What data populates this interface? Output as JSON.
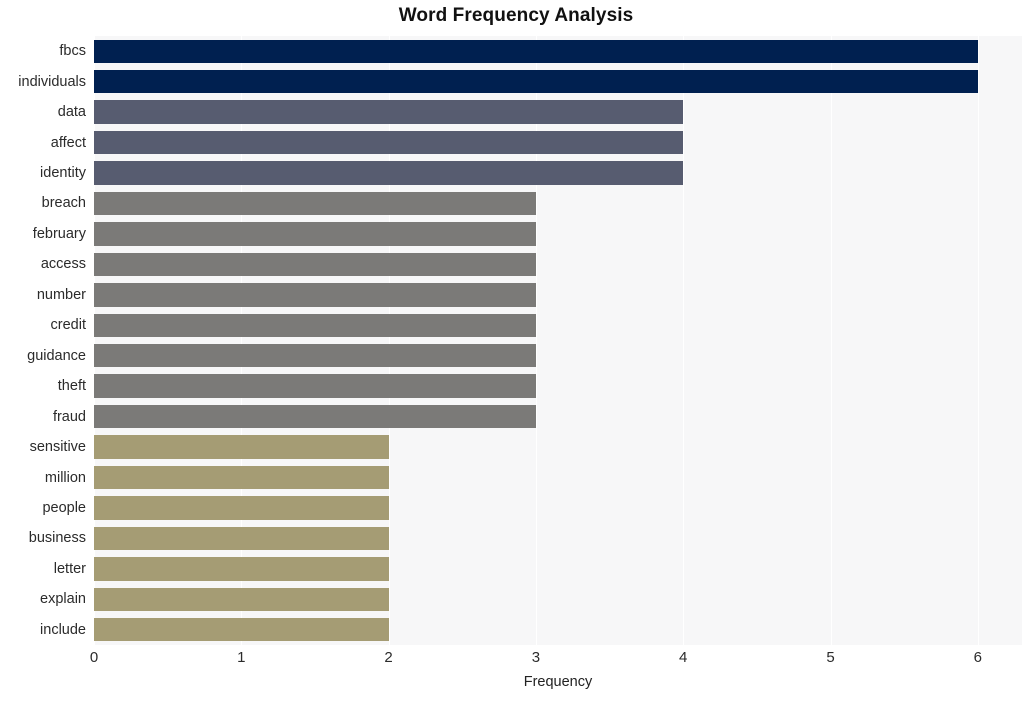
{
  "chart_data": {
    "type": "bar",
    "orientation": "horizontal",
    "title": "Word Frequency Analysis",
    "xlabel": "Frequency",
    "ylabel": "",
    "xlim": [
      0,
      6.3
    ],
    "xticks": [
      0,
      1,
      2,
      3,
      4,
      5,
      6
    ],
    "xtick_labels": [
      "0",
      "1",
      "2",
      "3",
      "4",
      "5",
      "6"
    ],
    "grid": true,
    "grid_axis": "x",
    "legend": false,
    "categories": [
      "fbcs",
      "individuals",
      "data",
      "affect",
      "identity",
      "breach",
      "february",
      "access",
      "number",
      "credit",
      "guidance",
      "theft",
      "fraud",
      "sensitive",
      "million",
      "people",
      "business",
      "letter",
      "explain",
      "include"
    ],
    "values": [
      6,
      6,
      4,
      4,
      4,
      3,
      3,
      3,
      3,
      3,
      3,
      3,
      3,
      2,
      2,
      2,
      2,
      2,
      2,
      2
    ],
    "bar_colors": [
      "#002050",
      "#002050",
      "#575c70",
      "#575c70",
      "#575c70",
      "#7b7a78",
      "#7b7a78",
      "#7b7a78",
      "#7b7a78",
      "#7b7a78",
      "#7b7a78",
      "#7b7a78",
      "#7b7a78",
      "#a59c74",
      "#a59c74",
      "#a59c74",
      "#a59c74",
      "#a59c74",
      "#a59c74",
      "#a59c74"
    ],
    "palette": {
      "highest": "#002050",
      "high": "#575c70",
      "medium": "#7b7a78",
      "low": "#a59c74"
    },
    "plot_background": "#f7f7f8",
    "grid_color": "#ffffff",
    "figure_background": "#ffffff",
    "text_color": "#2b2b2b"
  }
}
